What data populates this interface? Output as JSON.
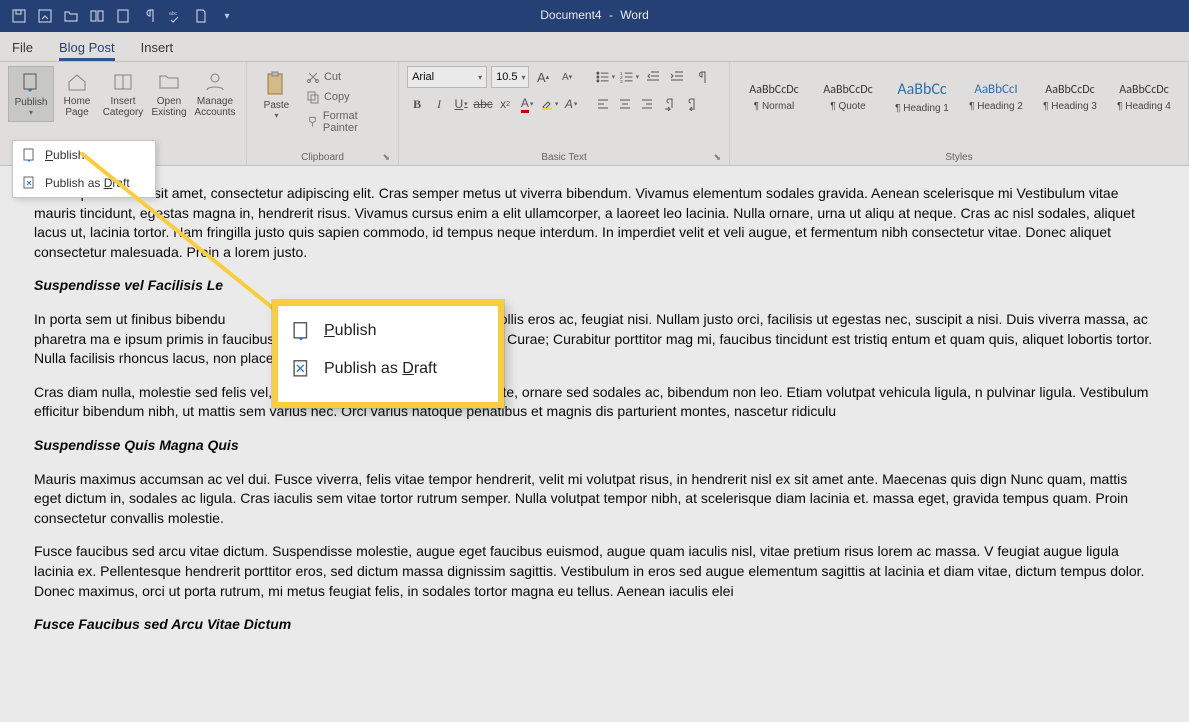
{
  "title": {
    "docname": "Document4",
    "sep": "-",
    "app": "Word"
  },
  "tabs": {
    "file": "File",
    "blogpost": "Blog Post",
    "insert": "Insert"
  },
  "groups": {
    "blog": {
      "publish": "Publish",
      "home": "Home Page",
      "insertcat": "Insert Category",
      "openexisting": "Open Existing",
      "manage": "Manage Accounts"
    },
    "clipboard": {
      "paste": "Paste",
      "cut": "Cut",
      "copy": "Copy",
      "format_painter": "Format Painter",
      "label": "Clipboard"
    },
    "basictext": {
      "font": "Arial",
      "size": "10.5",
      "label": "Basic Text"
    },
    "styles": {
      "label": "Styles",
      "items": [
        {
          "preview": "AaBbCcDc",
          "name": "¶ Normal"
        },
        {
          "preview": "AaBbCcDc",
          "name": "¶ Quote"
        },
        {
          "preview": "AaBbCc",
          "name": "¶ Heading 1"
        },
        {
          "preview": "AaBbCcI",
          "name": "¶ Heading 2"
        },
        {
          "preview": "AaBbCcDc",
          "name": "¶ Heading 3"
        },
        {
          "preview": "AaBbCcDc",
          "name": "¶ Heading 4"
        }
      ]
    }
  },
  "dropdown": {
    "publish": "Publish",
    "publish_draft": "Publish as Draft"
  },
  "zoom": {
    "publish": "Publish",
    "publish_draft": "Publish as Draft"
  },
  "document": {
    "p1": "Lorem ipsum dolor sit amet, consectetur adipiscing elit. Cras semper metus ut viverra bibendum. Vivamus elementum sodales gravida. Aenean scelerisque mi Vestibulum vitae mauris tincidunt, egestas magna in, hendrerit risus. Vivamus cursus enim a elit ullamcorper, a laoreet leo lacinia. Nulla ornare, urna ut aliqu at neque. Cras ac nisl sodales, aliquet lacus ut, lacinia tortor. Nam fringilla justo quis sapien commodo, id tempus neque interdum. In imperdiet velit et veli augue, et fermentum nibh consectetur vitae. Donec aliquet consectetur malesuada. Proin a lorem justo.",
    "h1": "Suspendisse vel Facilisis Le",
    "p2a": "In porta sem ut finibus bibendu",
    "p2b": "as, mollis eros ac, feugiat nisi. Nullam justo orci, facilisis ut egestas nec, suscipit a nisi. Duis viverra massa, ac pharetra ma                                                 e ipsum primis in faucibus orci luctus et ultrices posuere cubilia Curae; Curabitur porttitor mag mi, faucibus tincidunt est tristiq                                               entum et quam quis, aliquet lobortis tortor. Nulla facilisis rhoncus lacus, non placerat sem tr",
    "p3": "Cras diam nulla, molestie sed felis vel, egestas tempus nunc. Nullam leo ante, ornare sed sodales ac, bibendum non leo. Etiam volutpat vehicula ligula, n pulvinar ligula. Vestibulum efficitur bibendum nibh, ut mattis sem varius nec. Orci varius natoque penatibus et magnis dis parturient montes, nascetur ridiculu",
    "h2": "Suspendisse Quis Magna Quis",
    "p4": "Mauris maximus accumsan ac vel dui. Fusce viverra, felis vitae tempor hendrerit, velit mi volutpat risus, in hendrerit nisl ex sit amet ante. Maecenas quis dign Nunc quam, mattis eget dictum in, sodales ac ligula. Cras iaculis sem vitae tortor rutrum semper. Nulla volutpat tempor nibh, at scelerisque diam lacinia et. massa eget, gravida tempus quam. Proin consectetur convallis molestie.",
    "p5": "Fusce faucibus sed arcu vitae dictum. Suspendisse molestie, augue eget faucibus euismod, augue quam iaculis nisl, vitae pretium risus lorem ac massa. V feugiat augue ligula lacinia ex. Pellentesque hendrerit porttitor eros, sed dictum massa dignissim sagittis. Vestibulum in eros sed augue elementum sagittis at lacinia et diam vitae, dictum tempus dolor. Donec maximus, orci ut porta rutrum, mi metus feugiat felis, in sodales tortor magna eu tellus. Aenean iaculis elei",
    "h3": "Fusce Faucibus sed Arcu Vitae Dictum"
  }
}
